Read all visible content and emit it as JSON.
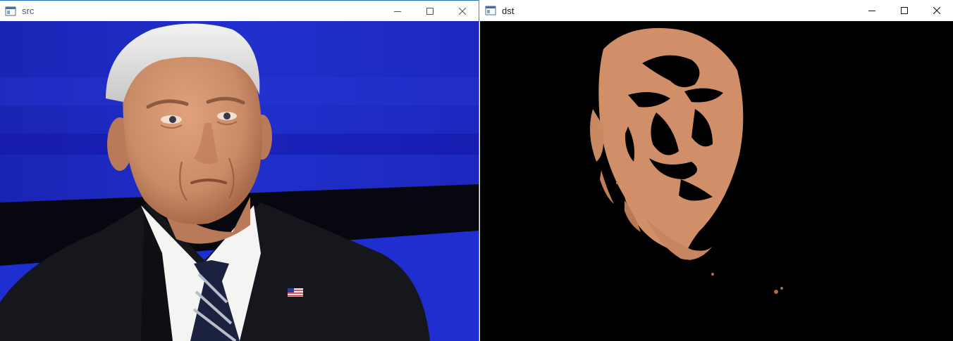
{
  "windows": [
    {
      "title": "src",
      "controls": {
        "minimize": "minimize",
        "maximize": "maximize",
        "close": "close"
      }
    },
    {
      "title": "dst",
      "controls": {
        "minimize": "minimize",
        "maximize": "maximize",
        "close": "close"
      }
    }
  ],
  "icons": {
    "app": "app-window-icon",
    "minimize": "minimize-icon",
    "maximize": "maximize-icon",
    "close": "close-icon"
  },
  "colors": {
    "titlebar_bg": "#ffffff",
    "backdrop_blue": "#1a2ac8",
    "skin": "#c98a66",
    "suit": "#15171c",
    "shirt": "#f4f4f2",
    "dst_bg": "#000000"
  }
}
